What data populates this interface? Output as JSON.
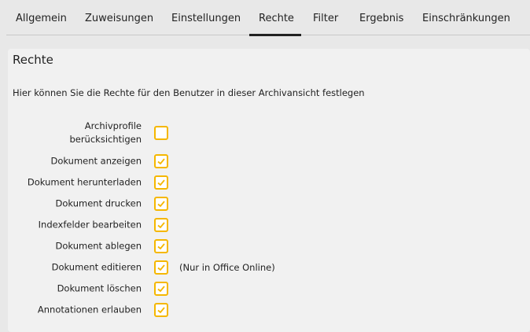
{
  "tabs": [
    {
      "label": "Allgemein"
    },
    {
      "label": "Zuweisungen"
    },
    {
      "label": "Einstellungen"
    },
    {
      "label": "Rechte",
      "active": true
    },
    {
      "label": "Filter"
    },
    {
      "label": "Ergebnis"
    },
    {
      "label": "Einschränkungen"
    }
  ],
  "section": {
    "title": "Rechte",
    "description": "Hier können Sie die Rechte für den Benutzer in dieser Archivansicht festlegen"
  },
  "colors": {
    "checkbox_accent": "#f5b700"
  },
  "permissions": [
    {
      "label": "Archivprofile berücksichtigen",
      "checked": false
    },
    {
      "label": "Dokument anzeigen",
      "checked": true
    },
    {
      "label": "Dokument herunterladen",
      "checked": true
    },
    {
      "label": "Dokument drucken",
      "checked": true
    },
    {
      "label": "Indexfelder bearbeiten",
      "checked": true
    },
    {
      "label": "Dokument ablegen",
      "checked": true
    },
    {
      "label": "Dokument editieren",
      "checked": true,
      "note": "(Nur in Office Online)"
    },
    {
      "label": "Dokument löschen",
      "checked": true
    },
    {
      "label": "Annotationen erlauben",
      "checked": true
    }
  ]
}
